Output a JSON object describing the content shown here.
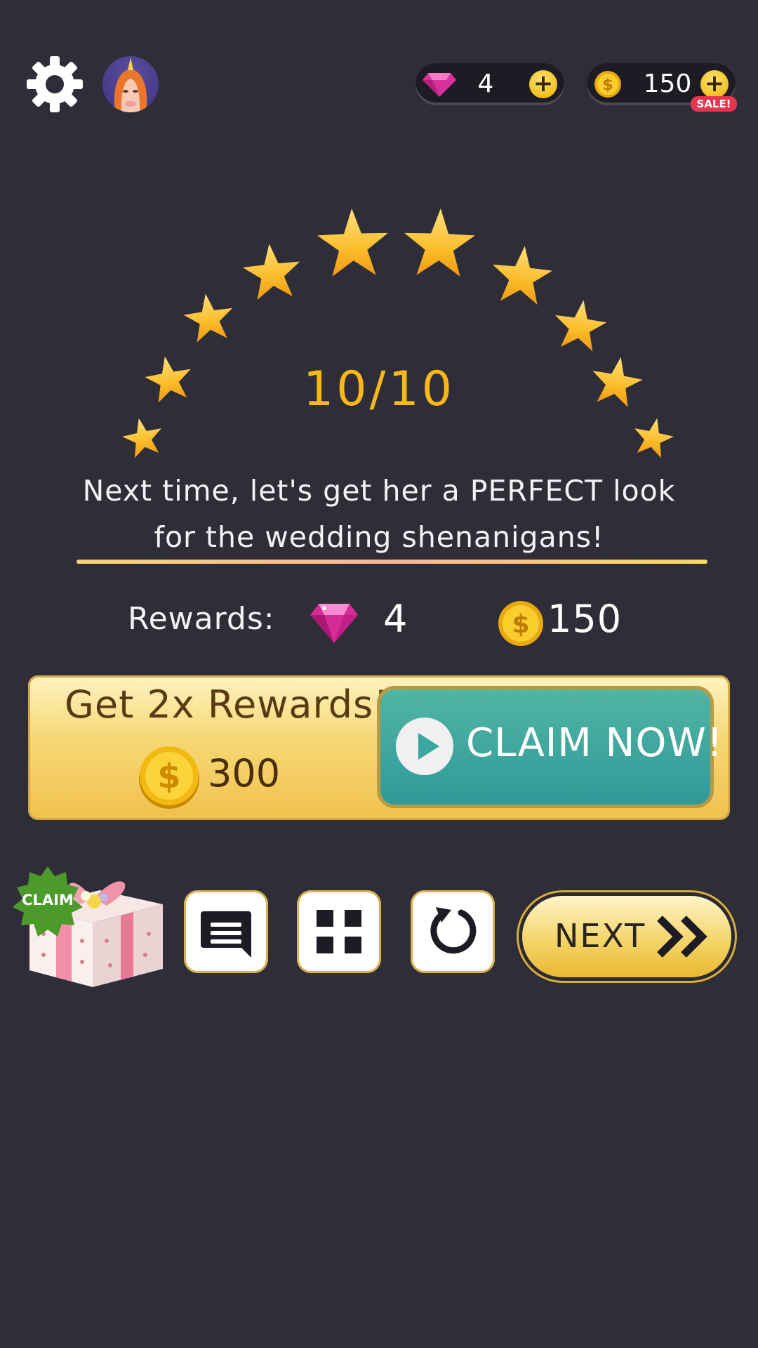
{
  "currency_bar": {
    "gems": "4",
    "coins": "150",
    "sale_badge": "SALE!"
  },
  "result": {
    "score": "10/10",
    "stars_earned": 10,
    "message": "Next time, let's get her a PERFECT look for the wedding shenanigans!"
  },
  "rewards": {
    "label": "Rewards:",
    "gems": "4",
    "coins": "150"
  },
  "double_offer": {
    "title": "Get 2x Rewards!",
    "coins": "300",
    "button_label": "CLAIM NOW!"
  },
  "bottom_bar": {
    "gift_badge": "CLAIM",
    "next_label": "NEXT"
  },
  "colors": {
    "background": "#2e2d38",
    "score": "#f8b816",
    "gold": "#f2bf1d",
    "teal": "#3aa6a0",
    "sale": "#e8354e",
    "claim_badge": "#4c9a2a"
  },
  "icons": [
    "gear-icon",
    "unicorn-avatar",
    "gem-icon",
    "coin-icon",
    "plus-icon",
    "star-icon",
    "play-icon",
    "chat-icon",
    "grid-icon",
    "restart-icon",
    "double-chevron-icon",
    "gift-icon"
  ]
}
